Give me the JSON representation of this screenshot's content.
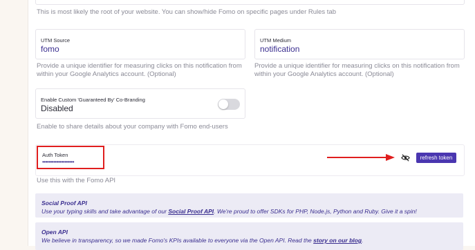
{
  "root_hint": "This is most likely the root of your website. You can show/hide Fomo on specific pages under Rules tab",
  "utm_source": {
    "label": "UTM Source",
    "value": "fomo",
    "hint": "Provide a unique identifier for measuring clicks on this notification from within your Google Analytics account. (Optional)"
  },
  "utm_medium": {
    "label": "UTM Medium",
    "value": "notification",
    "hint": "Provide a unique identifier for measuring clicks on this notification from within your Google Analytics account. (Optional)"
  },
  "cobranding": {
    "label": "Enable Custom 'Guaranteed By' Co-Branding",
    "value": "Disabled",
    "enabled": false,
    "hint": "Enable to share details about your company with Fomo end-users"
  },
  "auth": {
    "label": "Auth Token",
    "masked": "••••••••••••••••••••",
    "hint": "Use this with the Fomo API",
    "refresh_label": "refresh token"
  },
  "social_proof": {
    "title": "Social Proof API",
    "pre": "Use your typing skills and take advantage of our ",
    "link": "Social Proof API",
    "post": ". We're proud to offer SDKs for PHP, Node.js, Python and Ruby. Give it a spin!"
  },
  "open_api": {
    "title": "Open API",
    "pre": "We believe in transparency, so we made Fomo's KPIs available to everyone via the Open API. Read the ",
    "link": "story on our blog",
    "post": "."
  },
  "colors": {
    "accent": "#4a36b0",
    "annotation": "#e01e1e",
    "callout_bg": "#ecebf5"
  },
  "icons": {
    "reveal": "eye-slash-icon",
    "annotation": "arrow-right-icon"
  }
}
